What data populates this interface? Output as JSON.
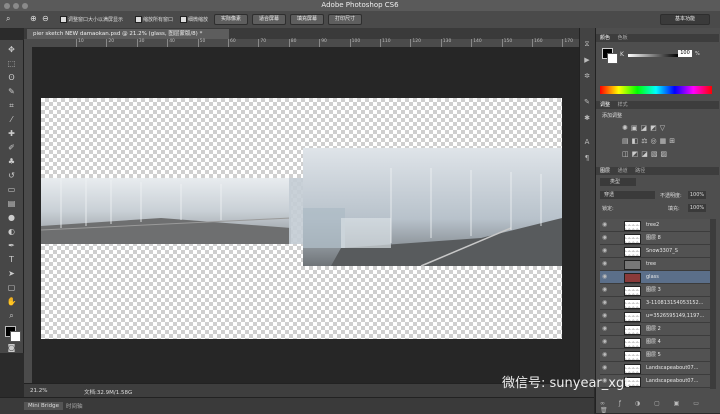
{
  "app": {
    "title": "Adobe Photoshop CS6"
  },
  "options_bar": {
    "zoom_symbol": "🔍",
    "check1": "调整窗口大小以满屏显示",
    "check2": "缩放所有窗口",
    "check3": "细微缩放",
    "btn_actual": "实际像素",
    "btn_fit": "适合屏幕",
    "btn_fill": "填充屏幕",
    "btn_print": "打印尺寸",
    "workspace": "基本功能"
  },
  "document": {
    "tab_title": "pier sketch NEW damaokan.psd @ 21.2% (glass, 图层蒙版/8) *"
  },
  "ruler": {
    "h_ticks": [
      "10",
      "20",
      "30",
      "40",
      "50",
      "60",
      "70",
      "80",
      "90",
      "100",
      "110",
      "120",
      "130",
      "140",
      "150",
      "160",
      "170"
    ]
  },
  "status": {
    "zoom": "21.2%",
    "doc": "文档:32.9M/1.58G"
  },
  "bottom": {
    "tab1": "Mini Bridge",
    "tab2": "时间轴"
  },
  "panels": {
    "color": {
      "tab1": "颜色",
      "tab2": "色板",
      "k_label": "K",
      "k_value": "100",
      "k_unit": "%"
    },
    "adjust": {
      "tab1": "调整",
      "tab2": "样式",
      "add_label": "添加调整"
    },
    "layers": {
      "tab1": "图层",
      "tab2": "通道",
      "tab3": "路径",
      "kind": "类型",
      "blend": "穿透",
      "opacity_label": "不透明度:",
      "opacity": "100%",
      "lock_label": "锁定:",
      "fill_label": "填充:",
      "fill": "100%",
      "items": [
        {
          "name": "tree2"
        },
        {
          "name": "图层 8"
        },
        {
          "name": "Snow3307_S"
        },
        {
          "name": "tree"
        },
        {
          "name": "glass"
        },
        {
          "name": "图层 3"
        },
        {
          "name": "3-110813154053152..."
        },
        {
          "name": "u=3526595149,1197..."
        },
        {
          "name": "图层 2"
        },
        {
          "name": "图层 4"
        },
        {
          "name": "图层 5"
        },
        {
          "name": "Landscapeabout07..."
        },
        {
          "name": "Landscapeabout07..."
        }
      ]
    }
  },
  "watermark": "微信号: sunyear_xgt",
  "colors": {
    "accent": "#5b6f8a",
    "panel": "#4e4e4e",
    "canvas_bg": "#262626"
  }
}
